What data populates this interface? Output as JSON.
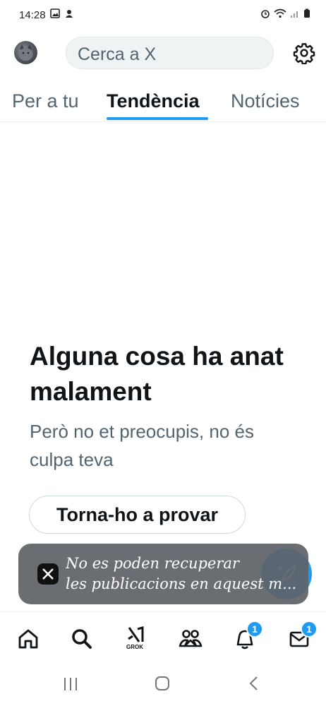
{
  "status_bar": {
    "time": "14:28"
  },
  "header": {
    "search_placeholder": "Cerca a X"
  },
  "tabs": [
    {
      "label": "Per a tu",
      "active": false
    },
    {
      "label": "Tendència",
      "active": true
    },
    {
      "label": "Notícies",
      "active": false
    }
  ],
  "error": {
    "title": "Alguna cosa ha anat malament",
    "subtitle": "Però no et preocupis, no és culpa teva",
    "retry_label": "Torna-ho a provar"
  },
  "toast": {
    "line1": "No es poden recuperar",
    "line2": "les publicacions en aquest m..."
  },
  "bottom_nav": {
    "grok_label": "GROK",
    "notifications_badge": "1",
    "messages_badge": "1"
  },
  "colors": {
    "accent": "#1d9bf0",
    "text": "#0f1419",
    "secondary": "#536471"
  }
}
